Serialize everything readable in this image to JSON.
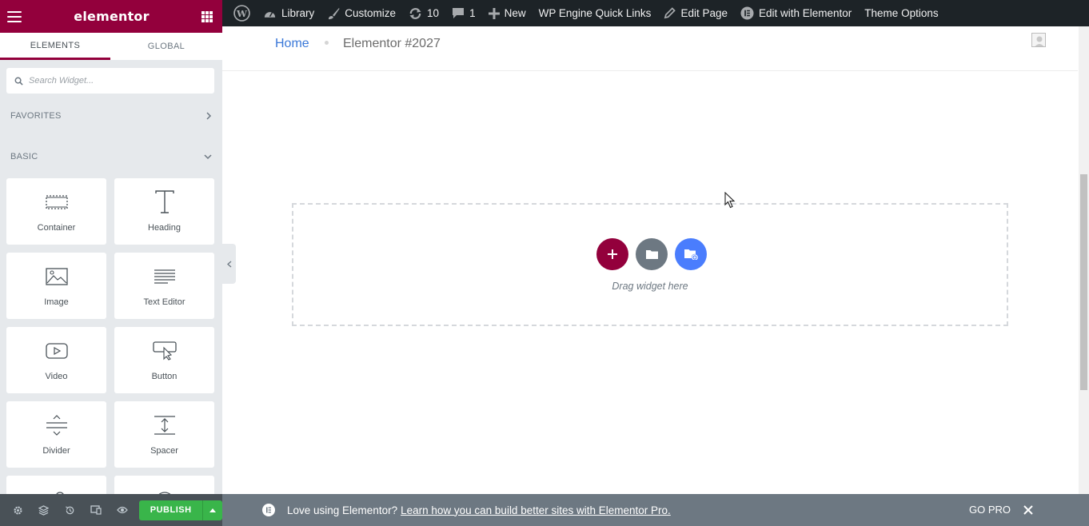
{
  "panel": {
    "brand": "elementor",
    "tabs": [
      {
        "label": "ELEMENTS",
        "active": true
      },
      {
        "label": "GLOBAL",
        "active": false
      }
    ],
    "search_placeholder": "Search Widget...",
    "categories": {
      "favorites": "FAVORITES",
      "basic": "BASIC"
    },
    "widgets": [
      {
        "label": "Container",
        "icon": "container-icon"
      },
      {
        "label": "Heading",
        "icon": "heading-icon"
      },
      {
        "label": "Image",
        "icon": "image-icon"
      },
      {
        "label": "Text Editor",
        "icon": "text-editor-icon"
      },
      {
        "label": "Video",
        "icon": "video-icon"
      },
      {
        "label": "Button",
        "icon": "button-icon"
      },
      {
        "label": "Divider",
        "icon": "divider-icon"
      },
      {
        "label": "Spacer",
        "icon": "spacer-icon"
      }
    ],
    "footer": {
      "publish_label": "PUBLISH",
      "icons": [
        "settings-icon",
        "navigator-icon",
        "history-icon",
        "responsive-icon",
        "preview-icon"
      ]
    }
  },
  "adminbar": {
    "items": [
      {
        "label": "",
        "icon": "wordpress-icon"
      },
      {
        "label": "Library",
        "icon": "dashboard-icon"
      },
      {
        "label": "Customize",
        "icon": "brush-icon"
      },
      {
        "label": "10",
        "icon": "updates-icon"
      },
      {
        "label": "1",
        "icon": "comments-icon"
      },
      {
        "label": "New",
        "icon": "plus-icon"
      },
      {
        "label": "WP Engine Quick Links",
        "icon": ""
      },
      {
        "label": "Edit Page",
        "icon": "pencil-icon"
      },
      {
        "label": "Edit with Elementor",
        "icon": "elementor-icon"
      },
      {
        "label": "Theme Options",
        "icon": ""
      }
    ]
  },
  "page": {
    "breadcrumb": {
      "home": "Home",
      "current": "Elementor #2027"
    },
    "drop_area": {
      "text": "Drag widget here"
    }
  },
  "notice": {
    "text": "Love using Elementor?",
    "link": "Learn how you can build better sites with Elementor Pro.",
    "gopro": "GO PRO"
  },
  "colors": {
    "brand": "#93003c",
    "panel_bg": "#e6e9ec",
    "adminbar_bg": "#1d2327",
    "publish_green": "#39b54a",
    "notice_bg": "#6d7882",
    "kit_blue": "#4a7dfd"
  }
}
